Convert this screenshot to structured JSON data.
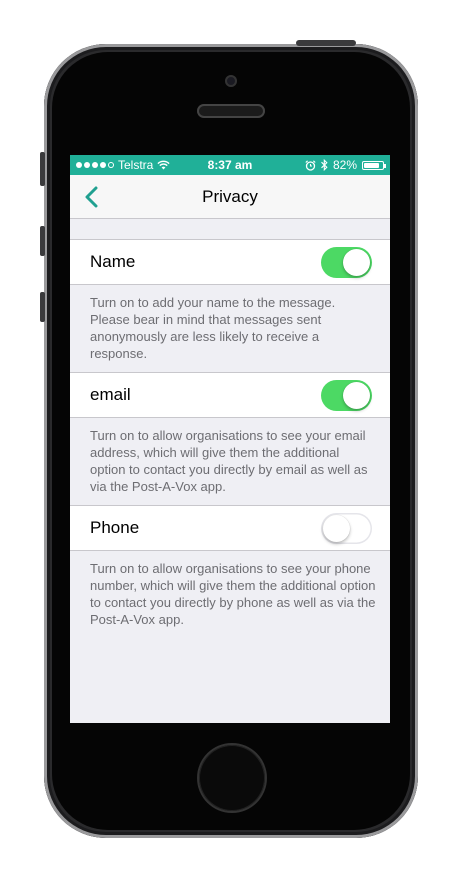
{
  "status_bar": {
    "carrier": "Telstra",
    "time": "8:37 am",
    "battery": "82%",
    "battery_level": 0.82,
    "signal_bars": 4,
    "color": "#20b098"
  },
  "navbar": {
    "back_icon": "chevron-left-icon",
    "title": "Privacy",
    "accent": "#20a090"
  },
  "settings": [
    {
      "label": "Name",
      "enabled": true,
      "description": "Turn on to add your name to the message. Please bear in mind that messages sent anonymously are less likely to receive a response."
    },
    {
      "label": "email",
      "enabled": true,
      "description": "Turn on to allow organisations to see your email address, which will give them the additional option to contact you directly by email as well as via the Post-A-Vox app."
    },
    {
      "label": "Phone",
      "enabled": false,
      "description": "Turn on to allow organisations to see your phone number, which will give them the additional option to contact you directly by phone as well as via the Post-A-Vox app."
    }
  ]
}
